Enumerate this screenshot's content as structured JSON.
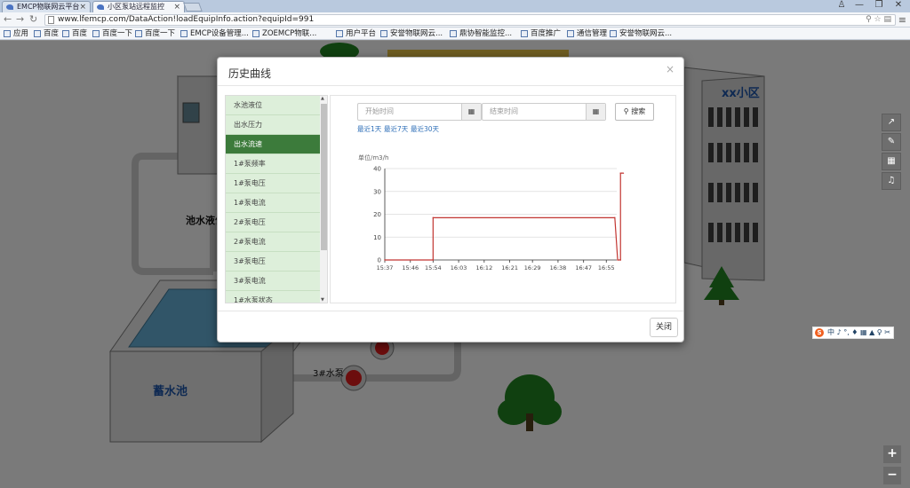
{
  "browser": {
    "tabs": [
      {
        "title": "EMCP物联网云平台"
      },
      {
        "title": "小区泵站远程监控"
      }
    ],
    "url": "www.lfemcp.com/DataAction!loadEquipInfo.action?equipId=991",
    "bookmarks": [
      "应用",
      "百度",
      "百度",
      "百度一下",
      "百度一下",
      "EMCP设备管理...",
      "ZOEMCP物联...",
      "用户平台",
      "安誉物联网云...",
      "鼎协智能监控...",
      "百度推广",
      "通信管理",
      "安誉物联网云..."
    ]
  },
  "scene": {
    "building_label": "xx小区",
    "pool_label": "蓄水池",
    "pool_level_label": "池水液位",
    "pump3_label": "3#水泵"
  },
  "dialog": {
    "title": "历史曲线",
    "close_button": "关闭",
    "params": [
      "水池液位",
      "出水压力",
      "出水流速",
      "1#泵频率",
      "1#泵电压",
      "1#泵电流",
      "2#泵电压",
      "2#泵电流",
      "3#泵电压",
      "3#泵电流",
      "1#水泵状态"
    ],
    "selected_param_index": 2,
    "start_placeholder": "开始时间",
    "end_placeholder": "结束时间",
    "search_button": "搜索",
    "quick_ranges": [
      "最近1天",
      "最近7天",
      "最近30天"
    ]
  },
  "chart_data": {
    "type": "line",
    "ylabel": "单位/m3/h",
    "ylim": [
      0,
      40
    ],
    "yticks": [
      0,
      10,
      20,
      30,
      40
    ],
    "xticks": [
      "15:37",
      "15:46",
      "15:54",
      "16:03",
      "16:12",
      "16:21",
      "16:29",
      "16:38",
      "16:47",
      "16:55"
    ],
    "grid": true,
    "series": [
      {
        "color": "#c23531",
        "x": [
          "15:37",
          "15:54",
          "15:54",
          "16:58",
          "16:59",
          "17:00",
          "17:00",
          "17:01"
        ],
        "y": [
          0,
          0,
          18.5,
          18.5,
          0,
          0,
          38,
          38
        ]
      }
    ]
  },
  "toolbar": {
    "icons": [
      "line-chart-icon",
      "edit-icon",
      "table-icon",
      "bell-icon"
    ],
    "zoom_in": "+",
    "zoom_out": "−"
  },
  "ime_text": "中 ♪ °, ♦ ▦ ▲ ♀ ✂"
}
